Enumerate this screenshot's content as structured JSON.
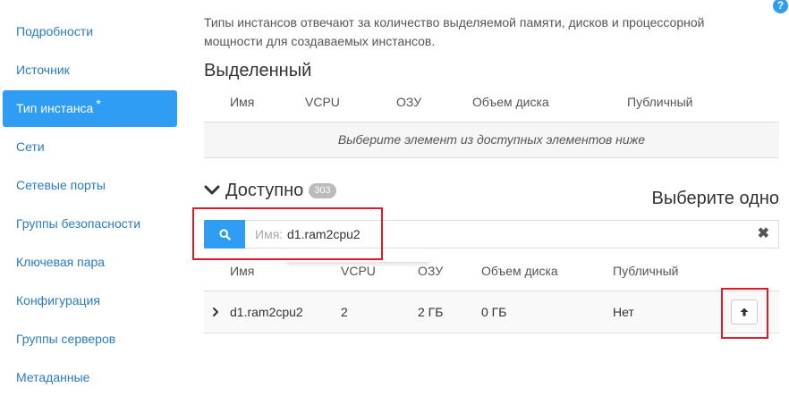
{
  "sidebar": {
    "items": [
      {
        "label": "Подробности"
      },
      {
        "label": "Источник"
      },
      {
        "label": "Тип инстанса",
        "required_mark": "*"
      },
      {
        "label": "Сети"
      },
      {
        "label": "Сетевые порты"
      },
      {
        "label": "Группы безопасности"
      },
      {
        "label": "Ключевая пара"
      },
      {
        "label": "Конфигурация"
      },
      {
        "label": "Группы серверов"
      },
      {
        "label": "Метаданные"
      }
    ]
  },
  "help": {
    "label": "?"
  },
  "description": "Типы инстансов отвечают за количество выделяемой памяти, дисков и процессорной мощности для создаваемых инстансов.",
  "allocated": {
    "title": "Выделенный",
    "columns": [
      "Имя",
      "VCPU",
      "ОЗУ",
      "Объем диска",
      "Публичный"
    ],
    "empty_message": "Выберите элемент из доступных элементов ниже"
  },
  "available": {
    "title": "Доступно",
    "count": "303",
    "choose_hint": "Выберите одно",
    "search": {
      "prefix": "Имя:",
      "value": "d1.ram2cpu2",
      "clear": "✖"
    },
    "columns": [
      "Имя",
      "VCPU",
      "ОЗУ",
      "Объем диска",
      "Публичный"
    ],
    "rows": [
      {
        "name": "d1.ram2cpu2",
        "vcpu": "2",
        "ram": "2 ГБ",
        "disk": "0 ГБ",
        "public": "Нет"
      }
    ]
  },
  "colors": {
    "accent": "#2e9df3",
    "highlight": "#d91c27",
    "link": "#2a7bc0"
  }
}
